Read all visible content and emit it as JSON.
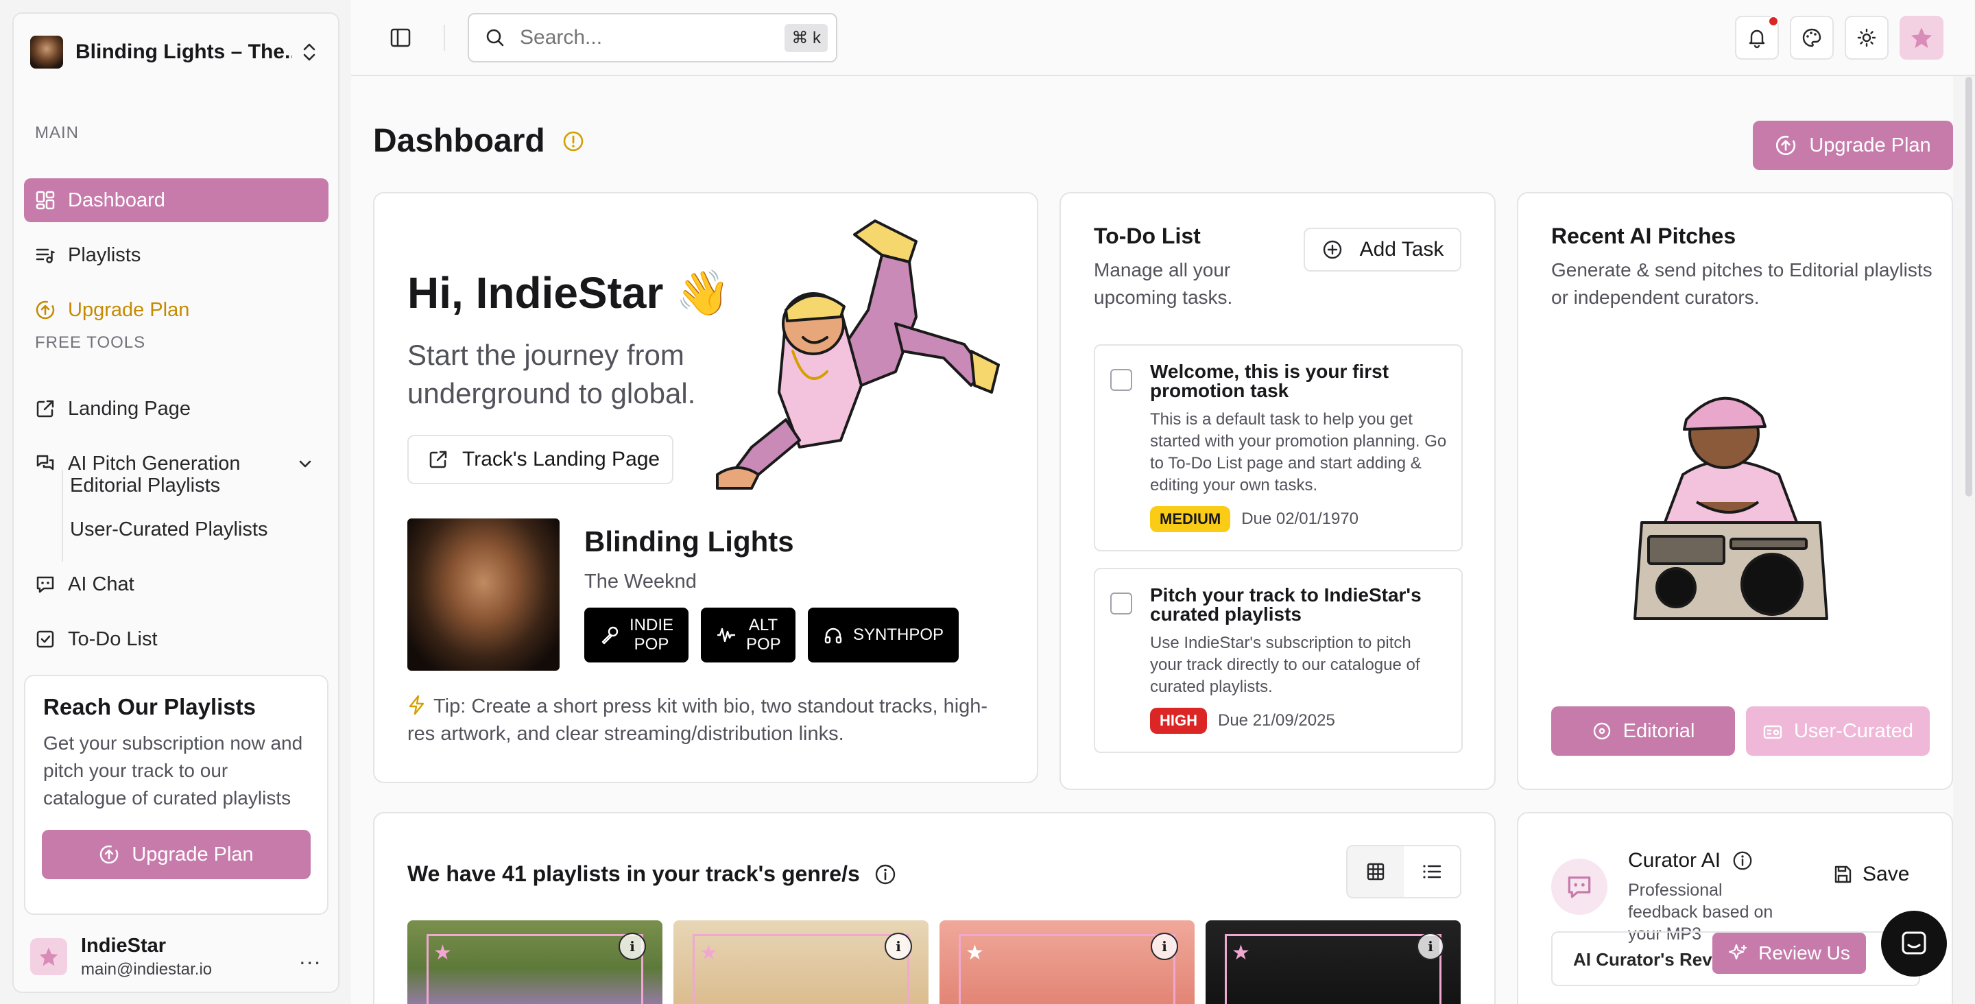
{
  "sidebar": {
    "track_title": "Blinding Lights – The...",
    "section_main": "MAIN",
    "section_free_tools": "FREE TOOLS",
    "items": {
      "dashboard": "Dashboard",
      "playlists": "Playlists",
      "upgrade_plan": "Upgrade Plan",
      "landing_page": "Landing Page",
      "ai_pitch_generation": "AI Pitch Generation",
      "editorial_playlists": "Editorial Playlists",
      "user_curated_playlists": "User-Curated Playlists",
      "ai_chat": "AI Chat",
      "todo_list": "To-Do List"
    },
    "promo": {
      "title": "Reach Our Playlists",
      "text": "Get your subscription now and pitch your track to our catalogue of curated playlists",
      "button": "Upgrade Plan"
    },
    "user": {
      "name": "IndieStar",
      "email": "main@indiestar.io",
      "more": "..."
    }
  },
  "topbar": {
    "search_placeholder": "Search...",
    "shortcut": "⌘ k"
  },
  "page": {
    "title": "Dashboard",
    "upgrade_button": "Upgrade Plan"
  },
  "hero": {
    "greeting": "Hi, IndieStar 👋",
    "tagline": "Start the journey from underground to global.",
    "landing_button": "Track's Landing Page",
    "track_name": "Blinding Lights",
    "artist": "The Weeknd",
    "tags": [
      "INDIE POP",
      "ALT POP",
      "SYNTHPOP"
    ],
    "tip": "Tip: Create a short press kit with bio, two standout tracks, high-res artwork, and clear streaming/distribution links."
  },
  "todo": {
    "title": "To-Do List",
    "description": "Manage all your upcoming tasks.",
    "add_button": "Add Task",
    "tasks": [
      {
        "title": "Welcome, this is your first promotion task",
        "description": "This is a default task to help you get started with your promotion planning. Go to To-Do List page and start adding & editing your own tasks.",
        "priority": "MEDIUM",
        "due": "Due 02/01/1970"
      },
      {
        "title": "Pitch your track to IndieStar's curated playlists",
        "description": "Use IndieStar's subscription to pitch your track directly to our catalogue of curated playlists.",
        "priority": "HIGH",
        "due": "Due 21/09/2025"
      }
    ]
  },
  "pitches": {
    "title": "Recent AI Pitches",
    "description": "Generate & send pitches to Editorial playlists or independent curators.",
    "editorial_button": "Editorial",
    "user_curated_button": "User-Curated"
  },
  "playlists": {
    "heading": "We have 41 playlists in your track's genre/s",
    "info_glyph": "i"
  },
  "curator": {
    "title": "Curator AI",
    "description": "Professional feedback based on your MP3",
    "save": "Save",
    "review_heading": "AI Curator's Review"
  },
  "floating": {
    "review_us": "Review Us"
  },
  "colors": {
    "accent": "#c67bab",
    "accent_light": "#efb8d8",
    "gold": "#c68a00",
    "medium_badge": "#facc15",
    "high_badge": "#dc2626"
  }
}
